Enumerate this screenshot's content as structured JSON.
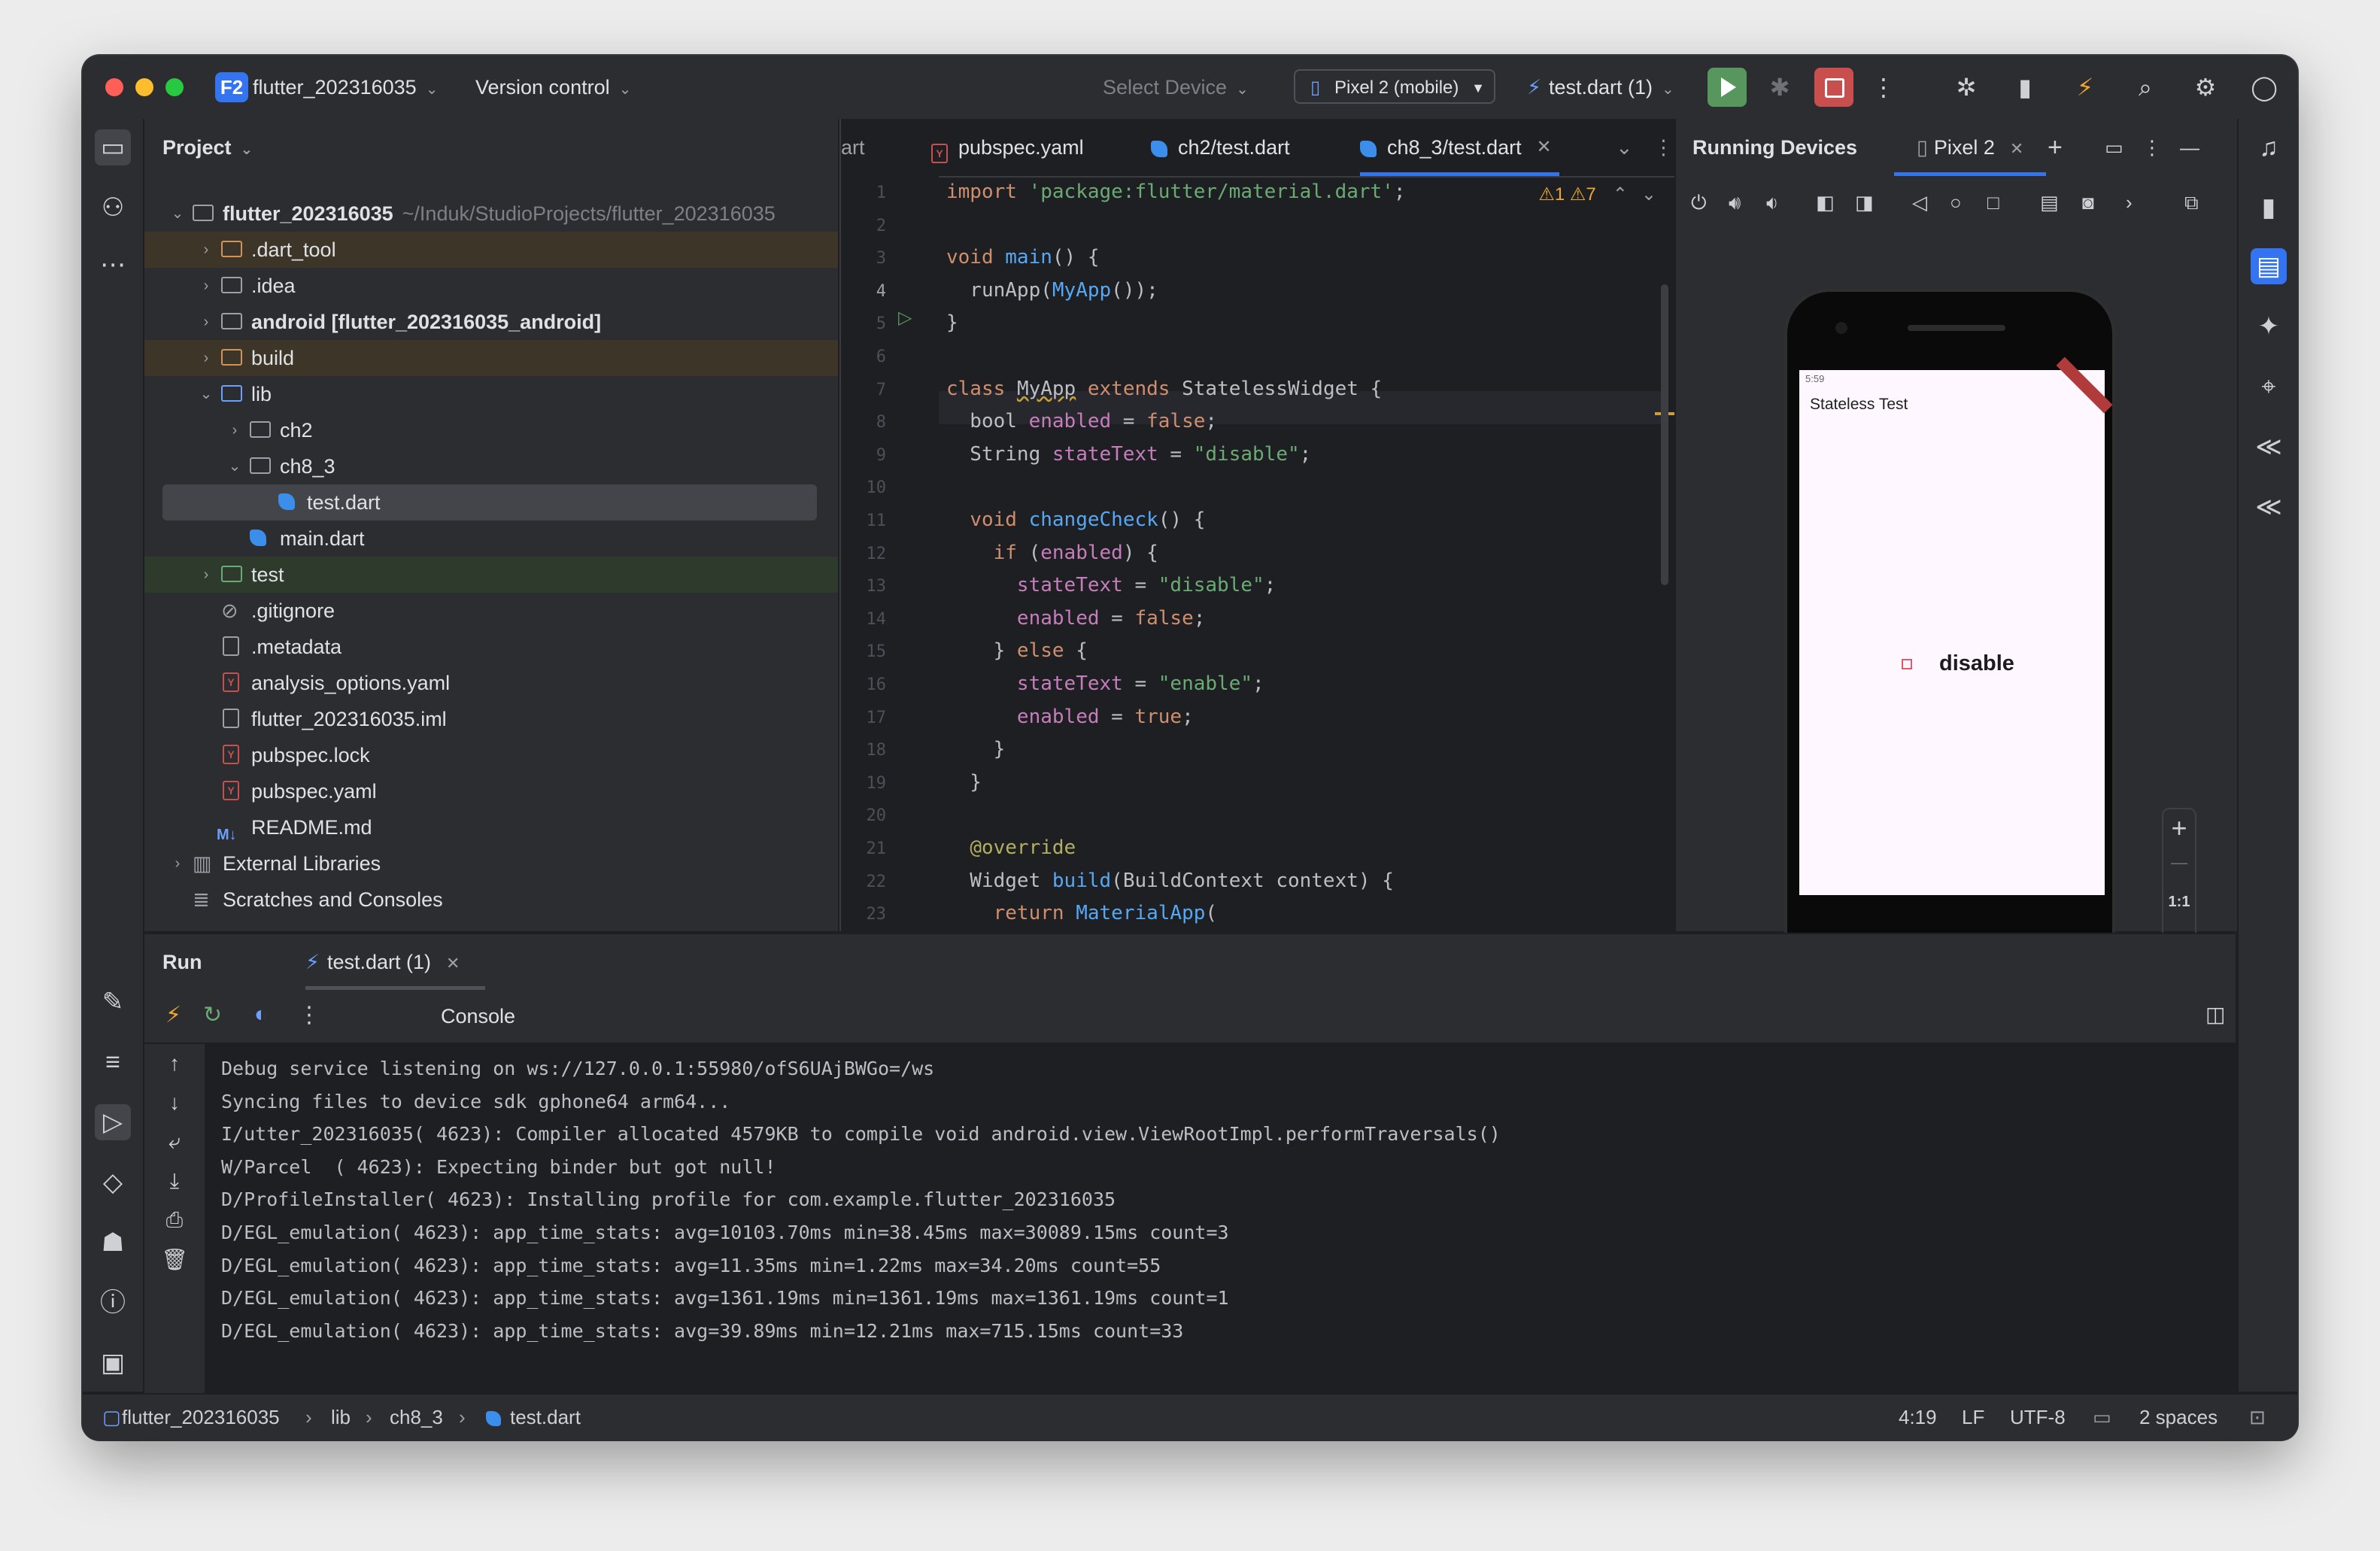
{
  "titlebar": {
    "project_badge": "F2",
    "project_name": "flutter_202316035",
    "version_control": "Version control",
    "select_device": "Select Device",
    "device": "Pixel 2 (mobile)",
    "run_config": "test.dart (1)"
  },
  "project_panel": {
    "title": "Project",
    "tree": [
      {
        "name": "flutter_202316035",
        "detail": "~/Induk/StudioProjects/flutter_202316035",
        "arrow": "⌄"
      },
      {
        "name": ".dart_tool",
        "arrow": "›"
      },
      {
        "name": ".idea",
        "arrow": "›"
      },
      {
        "name": "android [flutter_202316035_android]",
        "arrow": "›"
      },
      {
        "name": "build",
        "arrow": "›"
      },
      {
        "name": "lib",
        "arrow": "⌄"
      },
      {
        "name": "ch2",
        "arrow": "›"
      },
      {
        "name": "ch8_3",
        "arrow": "⌄"
      },
      {
        "name": "test.dart"
      },
      {
        "name": "main.dart"
      },
      {
        "name": "test",
        "arrow": "›"
      },
      {
        "name": ".gitignore"
      },
      {
        "name": ".metadata"
      },
      {
        "name": "analysis_options.yaml"
      },
      {
        "name": "flutter_202316035.iml"
      },
      {
        "name": "pubspec.lock"
      },
      {
        "name": "pubspec.yaml"
      },
      {
        "name": "README.md"
      },
      {
        "name": "External Libraries",
        "arrow": "›"
      },
      {
        "name": "Scratches and Consoles"
      }
    ],
    "yaml_glyph": "Y",
    "md_glyph": "M↓"
  },
  "editor": {
    "tabs": [
      "art",
      "pubspec.yaml",
      "ch2/test.dart",
      "ch8_3/test.dart"
    ],
    "warnings": "⚠1  ⚠7",
    "line_numbers": [
      "1",
      "2",
      "3",
      "4",
      "5",
      "6",
      "7",
      "8",
      "9",
      "10",
      "11",
      "12",
      "13",
      "14",
      "15",
      "16",
      "17",
      "18",
      "19",
      "20",
      "21",
      "22",
      "23"
    ]
  },
  "running_devices": {
    "title": "Running Devices",
    "tab": "Pixel 2",
    "phone_status_time": "5:59",
    "app_title": "Stateless Test",
    "checkbox_text": "disable",
    "zoom_plus": "+",
    "zoom_minus": "—",
    "zoom_reset": "1:1"
  },
  "run_panel": {
    "title": "Run",
    "tab": "test.dart (1)",
    "console_label": "Console",
    "console_lines": [
      "Debug service listening on ws://127.0.0.1:55980/ofS6UAjBWGo=/ws",
      "Syncing files to device sdk gphone64 arm64...",
      "I/utter_202316035( 4623): Compiler allocated 4579KB to compile void android.view.ViewRootImpl.performTraversals()",
      "W/Parcel  ( 4623): Expecting binder but got null!",
      "D/ProfileInstaller( 4623): Installing profile for com.example.flutter_202316035",
      "D/EGL_emulation( 4623): app_time_stats: avg=10103.70ms min=38.45ms max=30089.15ms count=3",
      "D/EGL_emulation( 4623): app_time_stats: avg=11.35ms min=1.22ms max=34.20ms count=55",
      "D/EGL_emulation( 4623): app_time_stats: avg=1361.19ms min=1361.19ms max=1361.19ms count=1",
      "D/EGL_emulation( 4623): app_time_stats: avg=39.89ms min=12.21ms max=715.15ms count=33"
    ]
  },
  "statusbar": {
    "breadcrumb": [
      "flutter_202316035",
      "lib",
      "ch8_3",
      "test.dart"
    ],
    "position": "4:19",
    "line_sep": "LF",
    "encoding": "UTF-8",
    "indent": "2 spaces"
  }
}
